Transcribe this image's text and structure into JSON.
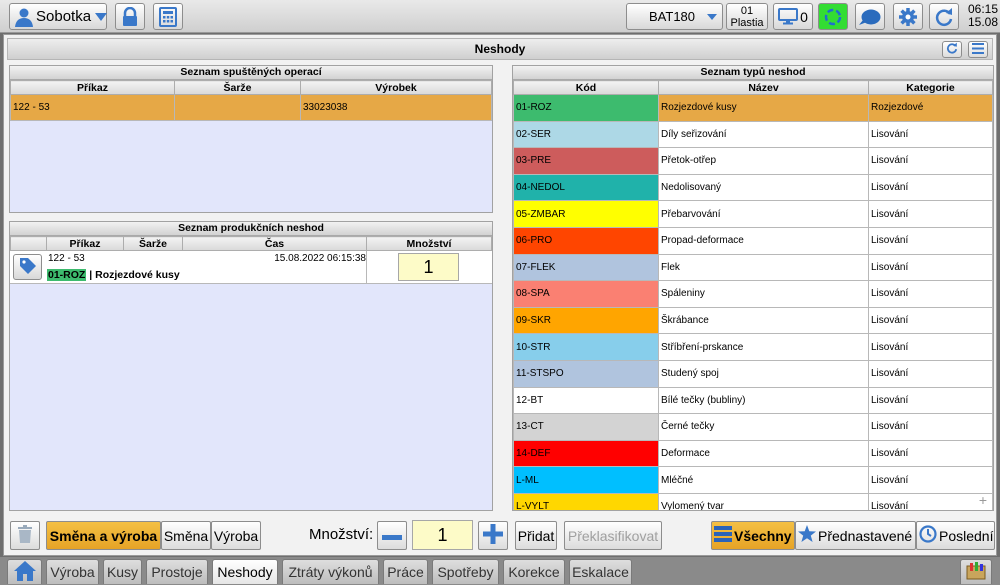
{
  "topbar": {
    "user_name": "Sobotka",
    "machine": "BAT180",
    "workplace_line1": "01",
    "workplace_line2": "Plastia",
    "monitor_count": "0",
    "time": "06:15",
    "date": "15.08"
  },
  "header": {
    "title": "Neshody"
  },
  "operations": {
    "title": "Seznam spuštěných operací",
    "columns": [
      "Příkaz",
      "Šarže",
      "Výrobek"
    ],
    "rows": [
      {
        "prikaz": "122 - 53",
        "sarze": "",
        "vyrobek": "33023038"
      }
    ]
  },
  "production": {
    "title": "Seznam produkčních neshod",
    "columns": [
      "Příkaz",
      "Šarže",
      "Čas",
      "Množství"
    ],
    "row": {
      "prikaz": "122 - 53",
      "sarze": "",
      "cas": "15.08.2022 06:15:38",
      "mnozstvi": "1",
      "code": "01-ROZ",
      "code_color": "#3dbb6e",
      "description": "| Rozjezdové kusy"
    }
  },
  "types": {
    "title": "Seznam typů neshod",
    "columns": [
      "Kód",
      "Název",
      "Kategorie"
    ],
    "rows": [
      {
        "code": "01-ROZ",
        "name": "Rozjezdové kusy",
        "category": "Rozjezdové",
        "color": "#3dbb6e",
        "selected": true
      },
      {
        "code": "02-SER",
        "name": "Díly seřizování",
        "category": "Lisování",
        "color": "#add8e6"
      },
      {
        "code": "03-PRE",
        "name": "Přetok-otřep",
        "category": "Lisování",
        "color": "#cd5c5c"
      },
      {
        "code": "04-NEDOL",
        "name": "Nedolisovaný",
        "category": "Lisování",
        "color": "#20b2aa"
      },
      {
        "code": "05-ZMBAR",
        "name": "Přebarvování",
        "category": "Lisování",
        "color": "#ffff00"
      },
      {
        "code": "06-PRO",
        "name": "Propad-deformace",
        "category": "Lisování",
        "color": "#ff4500"
      },
      {
        "code": "07-FLEK",
        "name": "Flek",
        "category": "Lisování",
        "color": "#b0c4de"
      },
      {
        "code": "08-SPA",
        "name": "Spáleniny",
        "category": "Lisování",
        "color": "#fa8072"
      },
      {
        "code": "09-SKR",
        "name": "Škrábance",
        "category": "Lisování",
        "color": "#ffa500"
      },
      {
        "code": "10-STR",
        "name": "Stříbření-prskance",
        "category": "Lisování",
        "color": "#87ceeb"
      },
      {
        "code": "11-STSPO",
        "name": "Studený spoj",
        "category": "Lisování",
        "color": "#b0c4de"
      },
      {
        "code": "12-BT",
        "name": "Bílé tečky (bubliny)",
        "category": "Lisování",
        "color": "#ffffff"
      },
      {
        "code": "13-CT",
        "name": "Černé tečky",
        "category": "Lisování",
        "color": "#d3d3d3"
      },
      {
        "code": "14-DEF",
        "name": "Deformace",
        "category": "Lisování",
        "color": "#ff0000"
      },
      {
        "code": "L-ML",
        "name": "Mléčné",
        "category": "Lisování",
        "color": "#00bfff"
      },
      {
        "code": "L-VYLT",
        "name": "Vylomený tvar",
        "category": "Lisování",
        "color": "#ffd700"
      }
    ]
  },
  "bottom": {
    "shift_and_production": "Směna a výroba",
    "shift": "Směna",
    "production": "Výroba",
    "quantity_label": "Množství:",
    "quantity_value": "1",
    "add": "Přidat",
    "reclassify": "Překlasifikovat",
    "all": "Všechny",
    "preset": "Přednastavené",
    "last": "Poslední"
  },
  "tabs": [
    "Výroba",
    "Kusy",
    "Prostoje",
    "Neshody",
    "Ztráty výkonů",
    "Práce",
    "Spotřeby",
    "Korekce",
    "Eskalace"
  ],
  "active_tab": "Neshody"
}
